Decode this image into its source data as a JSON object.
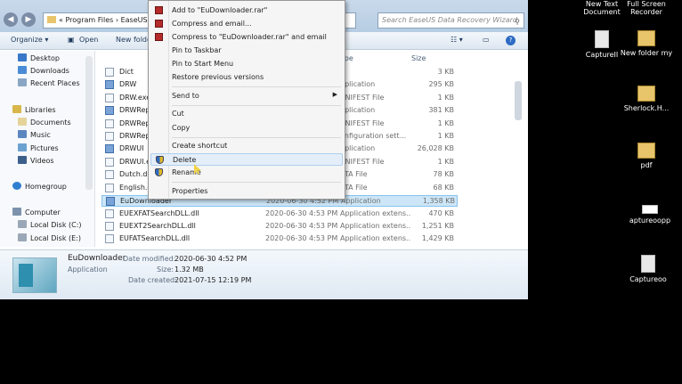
{
  "address": {
    "path": "« Program Files › EaseUS"
  },
  "search": {
    "placeholder": "Search EaseUS Data Recovery Wizard"
  },
  "toolbar": {
    "organize": "Organize ▾",
    "open": "Open",
    "new_folder": "New folder"
  },
  "sidebar": {
    "items": [
      {
        "label": "Desktop"
      },
      {
        "label": "Downloads"
      },
      {
        "label": "Recent Places"
      },
      {
        "label": "Libraries"
      },
      {
        "label": "Documents"
      },
      {
        "label": "Music"
      },
      {
        "label": "Pictures"
      },
      {
        "label": "Videos"
      },
      {
        "label": "Homegroup"
      },
      {
        "label": "Computer"
      },
      {
        "label": "Local Disk (C:)"
      },
      {
        "label": "Local Disk (E:)"
      }
    ]
  },
  "columns": {
    "type": "ype",
    "size": "Size"
  },
  "files": [
    {
      "name": "Dict",
      "date": "",
      "type": "e",
      "size": "3 KB"
    },
    {
      "name": "DRW",
      "date": "",
      "type": "pplication",
      "size": "295 KB"
    },
    {
      "name": "DRW.exe.",
      "date": "",
      "type": "ANIFEST File",
      "size": "1 KB"
    },
    {
      "name": "DRWRepo",
      "date": "",
      "type": "pplication",
      "size": "381 KB"
    },
    {
      "name": "DRWRepo",
      "date": "",
      "type": "ANIFEST File",
      "size": "1 KB"
    },
    {
      "name": "DRWRepo",
      "date": "",
      "type": "onfiguration sett...",
      "size": "1 KB"
    },
    {
      "name": "DRWUI",
      "date": "",
      "type": "pplication",
      "size": "26,028 KB"
    },
    {
      "name": "DRWUI.ex",
      "date": "",
      "type": "ANIFEST File",
      "size": "1 KB"
    },
    {
      "name": "Dutch.dat",
      "date": "",
      "type": "ATA File",
      "size": "78 KB"
    },
    {
      "name": "English.da",
      "date": "",
      "type": "ATA File",
      "size": "68 KB"
    },
    {
      "name": "EuDownloader",
      "date": "2020-06-30 4:52 PM",
      "type": "Application",
      "size": "1,358 KB"
    },
    {
      "name": "EUEXFATSearchDLL.dll",
      "date": "2020-06-30 4:53 PM",
      "type": "Application extens...",
      "size": "470 KB"
    },
    {
      "name": "EUEXT2SearchDLL.dll",
      "date": "2020-06-30 4:53 PM",
      "type": "Application extens...",
      "size": "1,251 KB"
    },
    {
      "name": "EUFATSearchDLL.dll",
      "date": "2020-06-30 4:53 PM",
      "type": "Application extens...",
      "size": "1,429 KB"
    }
  ],
  "details": {
    "name": "EuDownloader",
    "kind": "Application",
    "date_modified_label": "Date modified:",
    "date_modified": "2020-06-30 4:52 PM",
    "size_label": "Size:",
    "size": "1.32 MB",
    "date_created_label": "Date created:",
    "date_created": "2021-07-15 12:19 PM"
  },
  "context_menu": {
    "items": [
      {
        "label": "Add to \"EuDownloader.rar\""
      },
      {
        "label": "Compress and email..."
      },
      {
        "label": "Compress to \"EuDownloader.rar\" and email"
      },
      {
        "label": "Pin to Taskbar"
      },
      {
        "label": "Pin to Start Menu"
      },
      {
        "label": "Restore previous versions"
      },
      {
        "label": "Send to"
      },
      {
        "label": "Cut"
      },
      {
        "label": "Copy"
      },
      {
        "label": "Create shortcut"
      },
      {
        "label": "Delete"
      },
      {
        "label": "Rename"
      },
      {
        "label": "Properties"
      }
    ]
  },
  "desktop": {
    "icons": [
      {
        "label": "New Text Document"
      },
      {
        "label": "Full Screen Recorder"
      },
      {
        "label": "CaptureII"
      },
      {
        "label": "New folder my"
      },
      {
        "label": "Sherlock.H..."
      },
      {
        "label": "pdf"
      },
      {
        "label": "aptureoopp"
      },
      {
        "label": "Captureoo"
      }
    ]
  },
  "colors": {
    "selection": "#cde6f7",
    "menu_hover": "#e4eef9",
    "titlebar": "#c9d9ea"
  }
}
